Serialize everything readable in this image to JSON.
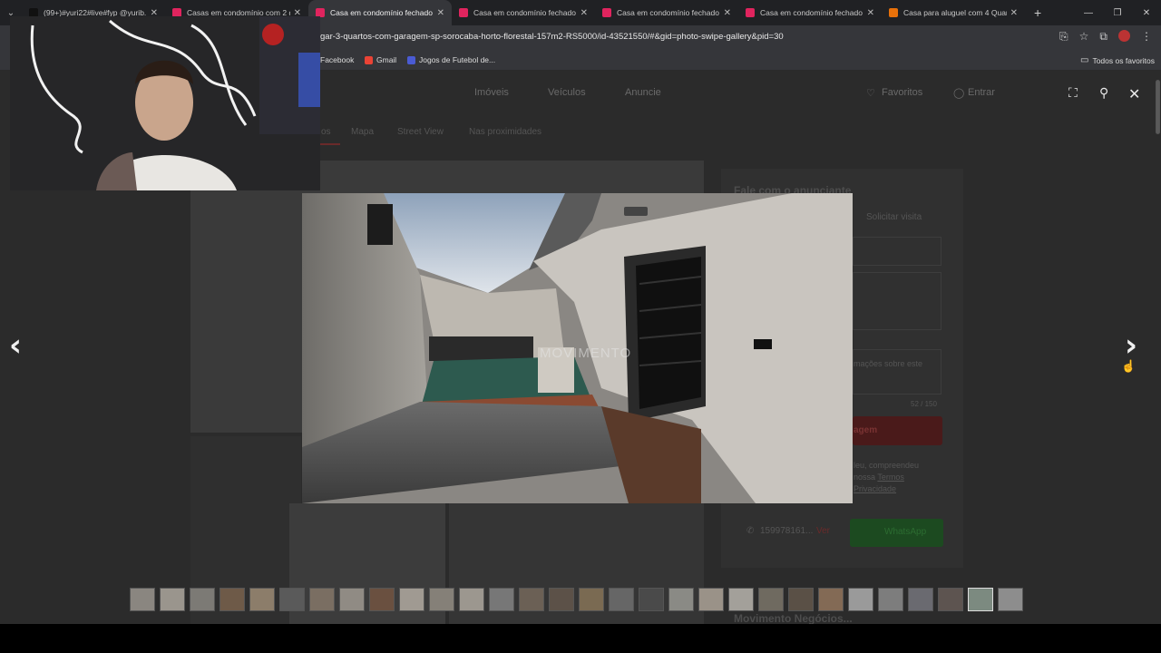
{
  "tabs": [
    {
      "title": "(99+)#yuri22#live#fyp @yurib...",
      "fav_color": "#111111",
      "active": false
    },
    {
      "title": "Casas em condomínio com 2 q...",
      "fav_color": "#e0245e",
      "active": false
    },
    {
      "title": "Casa em condomínio fechado ...",
      "fav_color": "#e0245e",
      "active": true
    },
    {
      "title": "Casa em condomínio fechado ...",
      "fav_color": "#e0245e",
      "active": false
    },
    {
      "title": "Casa em condomínio fechado ...",
      "fav_color": "#e0245e",
      "active": false
    },
    {
      "title": "Casa em condomínio fechado ...",
      "fav_color": "#e0245e",
      "active": false
    },
    {
      "title": "Casa para aluguel com 4 Quart...",
      "fav_color": "#e8710a",
      "active": false
    }
  ],
  "address": {
    "url": "gar-3-quartos-com-garagem-sp-sorocaba-horto-florestal-157m2-RS5000/id-43521550/#&gid=photo-swipe-gallery&pid=30"
  },
  "bookmarks": [
    {
      "label": "Facebook",
      "color": "#1877f2"
    },
    {
      "label": "Gmail",
      "color": "#ea4335"
    },
    {
      "label": "Jogos de Futebol de...",
      "color": "#4a5bd4"
    }
  ],
  "bookmarks_all": "Todos os favoritos",
  "site_nav": {
    "imoveis": "Imóveis",
    "veiculos": "Veículos",
    "anuncie": "Anuncie",
    "favoritos": "Favoritos",
    "entrar": "Entrar"
  },
  "listing_tabs": [
    "os",
    "Mapa",
    "Street View",
    "Nas proximidades"
  ],
  "contact": {
    "heading": "Fale com o anunciante",
    "visit": "Solicitar visita",
    "message_hint": "mações sobre este",
    "counter": "52 / 150",
    "send": "agem",
    "terms_1": "leu, compreendeu",
    "terms_2": "nossa",
    "terms_link": "Termos",
    "privacy": "Privacidade",
    "phone": "159978161...",
    "phone_reveal": "Ver",
    "whatsapp": "WhatsApp",
    "agency": "Movimento Negócios..."
  },
  "gallery": {
    "watermark": "MOVIMENTO",
    "thumb_count": 30,
    "active_index": 28
  },
  "icons": {
    "prev": "chevron-left-icon",
    "next": "chevron-right-icon",
    "close": "close-icon"
  }
}
